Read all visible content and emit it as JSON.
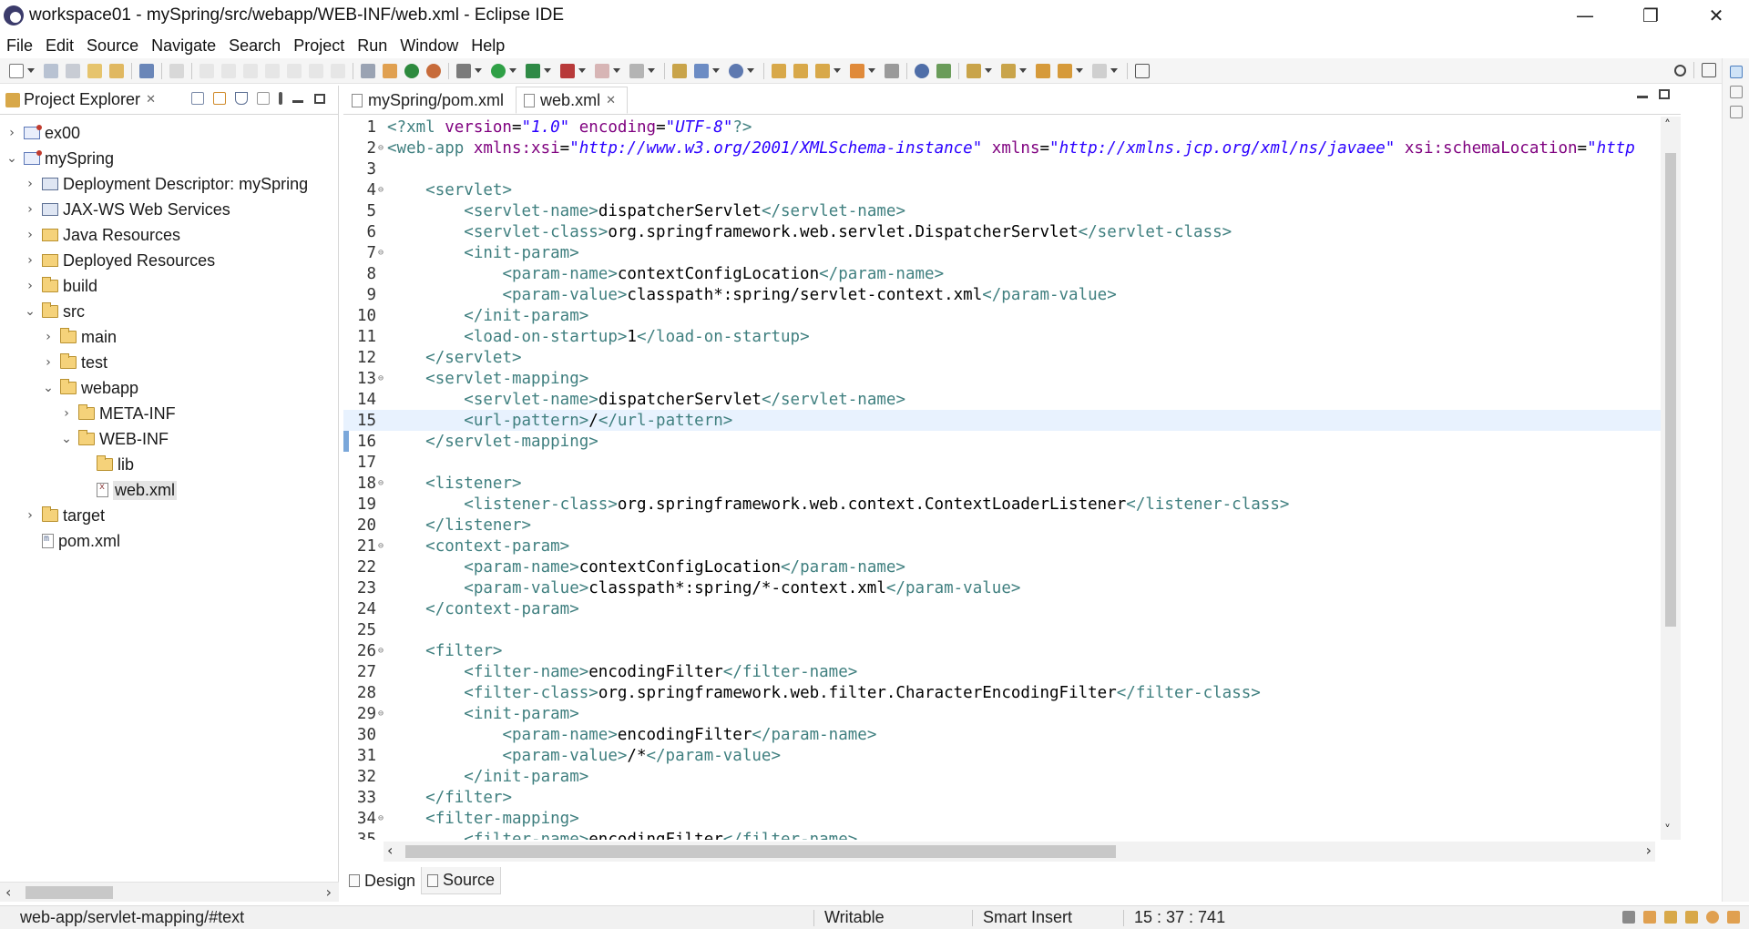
{
  "window": {
    "title": "workspace01 - mySpring/src/webapp/WEB-INF/web.xml - Eclipse IDE",
    "minimize_glyph": "—",
    "restore_glyph": "❐",
    "close_glyph": "✕"
  },
  "menu": [
    "File",
    "Edit",
    "Source",
    "Navigate",
    "Search",
    "Project",
    "Run",
    "Window",
    "Help"
  ],
  "explorer": {
    "tab_label": "Project Explorer",
    "tree": [
      {
        "label": "ex00",
        "depth": 0,
        "expanded": false,
        "icon": "project-icon"
      },
      {
        "label": "mySpring",
        "depth": 0,
        "expanded": true,
        "icon": "project-icon"
      },
      {
        "label": "Deployment Descriptor: mySpring",
        "depth": 1,
        "expanded": false,
        "icon": "descriptor-icon"
      },
      {
        "label": "JAX-WS Web Services",
        "depth": 1,
        "expanded": false,
        "icon": "jaxws-icon"
      },
      {
        "label": "Java Resources",
        "depth": 1,
        "expanded": false,
        "icon": "java-resources-icon"
      },
      {
        "label": "Deployed Resources",
        "depth": 1,
        "expanded": false,
        "icon": "deployed-resources-icon"
      },
      {
        "label": "build",
        "depth": 1,
        "expanded": false,
        "icon": "folder-icon"
      },
      {
        "label": "src",
        "depth": 1,
        "expanded": true,
        "icon": "folder-icon"
      },
      {
        "label": "main",
        "depth": 2,
        "expanded": false,
        "icon": "folder-icon"
      },
      {
        "label": "test",
        "depth": 2,
        "expanded": false,
        "icon": "folder-icon"
      },
      {
        "label": "webapp",
        "depth": 2,
        "expanded": true,
        "icon": "folder-icon"
      },
      {
        "label": "META-INF",
        "depth": 3,
        "expanded": false,
        "icon": "folder-icon"
      },
      {
        "label": "WEB-INF",
        "depth": 3,
        "expanded": true,
        "icon": "folder-icon"
      },
      {
        "label": "lib",
        "depth": 4,
        "expanded": null,
        "icon": "folder-icon"
      },
      {
        "label": "web.xml",
        "depth": 4,
        "expanded": null,
        "icon": "xml-file-icon",
        "selected": true
      },
      {
        "label": "target",
        "depth": 1,
        "expanded": false,
        "icon": "folder-icon"
      },
      {
        "label": "pom.xml",
        "depth": 1,
        "expanded": null,
        "icon": "pom-file-icon"
      }
    ]
  },
  "editor": {
    "tabs": [
      {
        "label": "mySpring/pom.xml",
        "active": false
      },
      {
        "label": "web.xml",
        "active": true
      }
    ],
    "current_line": 15,
    "lines": [
      {
        "n": "1",
        "fold": false,
        "segs": [
          [
            "pi",
            "<?xml "
          ],
          [
            "attr",
            "version"
          ],
          [
            "txt",
            "="
          ],
          [
            "val",
            "\"1.0\""
          ],
          [
            "txt",
            " "
          ],
          [
            "attr",
            "encoding"
          ],
          [
            "txt",
            "="
          ],
          [
            "val",
            "\"UTF-8\""
          ],
          [
            "pi",
            "?>"
          ]
        ]
      },
      {
        "n": "2",
        "fold": true,
        "segs": [
          [
            "tag",
            "<web-app "
          ],
          [
            "attr",
            "xmlns:xsi"
          ],
          [
            "txt",
            "="
          ],
          [
            "val",
            "\"http://www.w3.org/2001/XMLSchema-instance\""
          ],
          [
            "txt",
            " "
          ],
          [
            "attr",
            "xmlns"
          ],
          [
            "txt",
            "="
          ],
          [
            "val",
            "\"http://xmlns.jcp.org/xml/ns/javaee\""
          ],
          [
            "txt",
            " "
          ],
          [
            "attr",
            "xsi:schemaLocation"
          ],
          [
            "txt",
            "="
          ],
          [
            "val",
            "\"http"
          ]
        ]
      },
      {
        "n": "3",
        "fold": false,
        "segs": []
      },
      {
        "n": "4",
        "fold": true,
        "segs": [
          [
            "txt",
            "    "
          ],
          [
            "tag",
            "<servlet>"
          ]
        ]
      },
      {
        "n": "5",
        "fold": false,
        "segs": [
          [
            "txt",
            "        "
          ],
          [
            "tag",
            "<servlet-name>"
          ],
          [
            "txt",
            "dispatcherServlet"
          ],
          [
            "tag",
            "</servlet-name>"
          ]
        ]
      },
      {
        "n": "6",
        "fold": false,
        "segs": [
          [
            "txt",
            "        "
          ],
          [
            "tag",
            "<servlet-class>"
          ],
          [
            "txt",
            "org.springframework.web.servlet.DispatcherServlet"
          ],
          [
            "tag",
            "</servlet-class>"
          ]
        ]
      },
      {
        "n": "7",
        "fold": true,
        "segs": [
          [
            "txt",
            "        "
          ],
          [
            "tag",
            "<init-param>"
          ]
        ]
      },
      {
        "n": "8",
        "fold": false,
        "segs": [
          [
            "txt",
            "            "
          ],
          [
            "tag",
            "<param-name>"
          ],
          [
            "txt",
            "contextConfigLocation"
          ],
          [
            "tag",
            "</param-name>"
          ]
        ]
      },
      {
        "n": "9",
        "fold": false,
        "segs": [
          [
            "txt",
            "            "
          ],
          [
            "tag",
            "<param-value>"
          ],
          [
            "txt",
            "classpath*:spring/servlet-context.xml"
          ],
          [
            "tag",
            "</param-value>"
          ]
        ]
      },
      {
        "n": "10",
        "fold": false,
        "segs": [
          [
            "txt",
            "        "
          ],
          [
            "tag",
            "</init-param>"
          ]
        ]
      },
      {
        "n": "11",
        "fold": false,
        "segs": [
          [
            "txt",
            "        "
          ],
          [
            "tag",
            "<load-on-startup>"
          ],
          [
            "txt",
            "1"
          ],
          [
            "tag",
            "</load-on-startup>"
          ]
        ]
      },
      {
        "n": "12",
        "fold": false,
        "segs": [
          [
            "txt",
            "    "
          ],
          [
            "tag",
            "</servlet>"
          ]
        ]
      },
      {
        "n": "13",
        "fold": true,
        "segs": [
          [
            "txt",
            "    "
          ],
          [
            "tag",
            "<servlet-mapping>"
          ]
        ]
      },
      {
        "n": "14",
        "fold": false,
        "segs": [
          [
            "txt",
            "        "
          ],
          [
            "tag",
            "<servlet-name>"
          ],
          [
            "txt",
            "dispatcherServlet"
          ],
          [
            "tag",
            "</servlet-name>"
          ]
        ]
      },
      {
        "n": "15",
        "fold": false,
        "segs": [
          [
            "txt",
            "        "
          ],
          [
            "tag",
            "<url-pattern>"
          ],
          [
            "txt",
            "/"
          ],
          [
            "tag",
            "</url-pattern>"
          ]
        ]
      },
      {
        "n": "16",
        "fold": false,
        "segs": [
          [
            "txt",
            "    "
          ],
          [
            "tag",
            "</servlet-mapping>"
          ]
        ]
      },
      {
        "n": "17",
        "fold": false,
        "segs": []
      },
      {
        "n": "18",
        "fold": true,
        "segs": [
          [
            "txt",
            "    "
          ],
          [
            "tag",
            "<listener>"
          ]
        ]
      },
      {
        "n": "19",
        "fold": false,
        "segs": [
          [
            "txt",
            "        "
          ],
          [
            "tag",
            "<listener-class>"
          ],
          [
            "txt",
            "org.springframework.web.context.ContextLoaderListener"
          ],
          [
            "tag",
            "</listener-class>"
          ]
        ]
      },
      {
        "n": "20",
        "fold": false,
        "segs": [
          [
            "txt",
            "    "
          ],
          [
            "tag",
            "</listener>"
          ]
        ]
      },
      {
        "n": "21",
        "fold": true,
        "segs": [
          [
            "txt",
            "    "
          ],
          [
            "tag",
            "<context-param>"
          ]
        ]
      },
      {
        "n": "22",
        "fold": false,
        "segs": [
          [
            "txt",
            "        "
          ],
          [
            "tag",
            "<param-name>"
          ],
          [
            "txt",
            "contextConfigLocation"
          ],
          [
            "tag",
            "</param-name>"
          ]
        ]
      },
      {
        "n": "23",
        "fold": false,
        "segs": [
          [
            "txt",
            "        "
          ],
          [
            "tag",
            "<param-value>"
          ],
          [
            "txt",
            "classpath*:spring/*-context.xml"
          ],
          [
            "tag",
            "</param-value>"
          ]
        ]
      },
      {
        "n": "24",
        "fold": false,
        "segs": [
          [
            "txt",
            "    "
          ],
          [
            "tag",
            "</context-param>"
          ]
        ]
      },
      {
        "n": "25",
        "fold": false,
        "segs": []
      },
      {
        "n": "26",
        "fold": true,
        "segs": [
          [
            "txt",
            "    "
          ],
          [
            "tag",
            "<filter>"
          ]
        ]
      },
      {
        "n": "27",
        "fold": false,
        "segs": [
          [
            "txt",
            "        "
          ],
          [
            "tag",
            "<filter-name>"
          ],
          [
            "txt",
            "encodingFilter"
          ],
          [
            "tag",
            "</filter-name>"
          ]
        ]
      },
      {
        "n": "28",
        "fold": false,
        "segs": [
          [
            "txt",
            "        "
          ],
          [
            "tag",
            "<filter-class>"
          ],
          [
            "txt",
            "org.springframework.web.filter.CharacterEncodingFilter"
          ],
          [
            "tag",
            "</filter-class>"
          ]
        ]
      },
      {
        "n": "29",
        "fold": true,
        "segs": [
          [
            "txt",
            "        "
          ],
          [
            "tag",
            "<init-param>"
          ]
        ]
      },
      {
        "n": "30",
        "fold": false,
        "segs": [
          [
            "txt",
            "            "
          ],
          [
            "tag",
            "<param-name>"
          ],
          [
            "txt",
            "encodingFilter"
          ],
          [
            "tag",
            "</param-name>"
          ]
        ]
      },
      {
        "n": "31",
        "fold": false,
        "segs": [
          [
            "txt",
            "            "
          ],
          [
            "tag",
            "<param-value>"
          ],
          [
            "txt",
            "/*"
          ],
          [
            "tag",
            "</param-value>"
          ]
        ]
      },
      {
        "n": "32",
        "fold": false,
        "segs": [
          [
            "txt",
            "        "
          ],
          [
            "tag",
            "</init-param>"
          ]
        ]
      },
      {
        "n": "33",
        "fold": false,
        "segs": [
          [
            "txt",
            "    "
          ],
          [
            "tag",
            "</filter>"
          ]
        ]
      },
      {
        "n": "34",
        "fold": true,
        "segs": [
          [
            "txt",
            "    "
          ],
          [
            "tag",
            "<filter-mapping>"
          ]
        ]
      },
      {
        "n": "35",
        "fold": false,
        "segs": [
          [
            "txt",
            "        "
          ],
          [
            "tag",
            "<filter-name>"
          ],
          [
            "txt",
            "encodingFilter"
          ],
          [
            "tag",
            "</filter-name>"
          ]
        ]
      }
    ],
    "bottom_tabs": [
      {
        "label": "Design",
        "active": false
      },
      {
        "label": "Source",
        "active": true
      }
    ]
  },
  "status": {
    "path": "web-app/servlet-mapping/#text",
    "writable": "Writable",
    "insert_mode": "Smart Insert",
    "position": "15 : 37 : 741"
  },
  "colors": {
    "tag": "#3f7f7f",
    "attribute": "#7f007f",
    "attribute_value": "#2a00ff",
    "current_line": "#e8f2fe",
    "selection": "#e4e4e4"
  }
}
